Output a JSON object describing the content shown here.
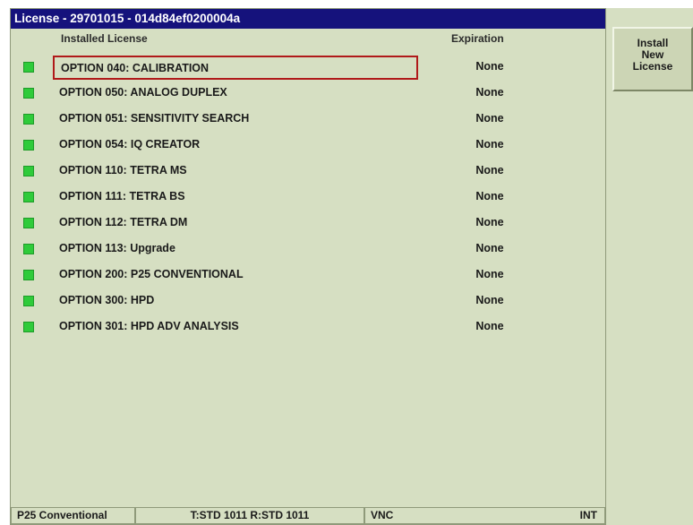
{
  "window": {
    "title": "License - 29701015 - 014d84ef0200004a"
  },
  "table": {
    "columns": {
      "license": "Installed License",
      "expiration": "Expiration"
    },
    "rows": [
      {
        "name": "OPTION 040: CALIBRATION",
        "expiration": "None",
        "status_color": "#2fcb3a",
        "selected": true
      },
      {
        "name": "OPTION 050: ANALOG DUPLEX",
        "expiration": "None",
        "status_color": "#2fcb3a",
        "selected": false
      },
      {
        "name": "OPTION 051: SENSITIVITY SEARCH",
        "expiration": "None",
        "status_color": "#2fcb3a",
        "selected": false
      },
      {
        "name": "OPTION 054: IQ CREATOR",
        "expiration": "None",
        "status_color": "#2fcb3a",
        "selected": false
      },
      {
        "name": "OPTION 110: TETRA MS",
        "expiration": "None",
        "status_color": "#2fcb3a",
        "selected": false
      },
      {
        "name": "OPTION 111: TETRA BS",
        "expiration": "None",
        "status_color": "#2fcb3a",
        "selected": false
      },
      {
        "name": "OPTION 112: TETRA DM",
        "expiration": "None",
        "status_color": "#2fcb3a",
        "selected": false
      },
      {
        "name": "OPTION 113: Upgrade",
        "expiration": "None",
        "status_color": "#2fcb3a",
        "selected": false
      },
      {
        "name": "OPTION 200: P25 CONVENTIONAL",
        "expiration": "None",
        "status_color": "#2fcb3a",
        "selected": false
      },
      {
        "name": "OPTION 300: HPD",
        "expiration": "None",
        "status_color": "#2fcb3a",
        "selected": false
      },
      {
        "name": "OPTION 301: HPD ADV ANALYSIS",
        "expiration": "None",
        "status_color": "#2fcb3a",
        "selected": false
      }
    ]
  },
  "status_bar": {
    "mode": "P25 Conventional",
    "standard": "T:STD 1011 R:STD 1011",
    "remote": "VNC",
    "reference": "INT"
  },
  "softkeys": {
    "install_line1": "Install",
    "install_line2": "New",
    "install_line3": "License"
  },
  "colors": {
    "title_bar": "#15127c",
    "panel_background": "#d6dfc2",
    "status_ok": "#2fcb3a",
    "selection_border": "#b01a1a"
  }
}
